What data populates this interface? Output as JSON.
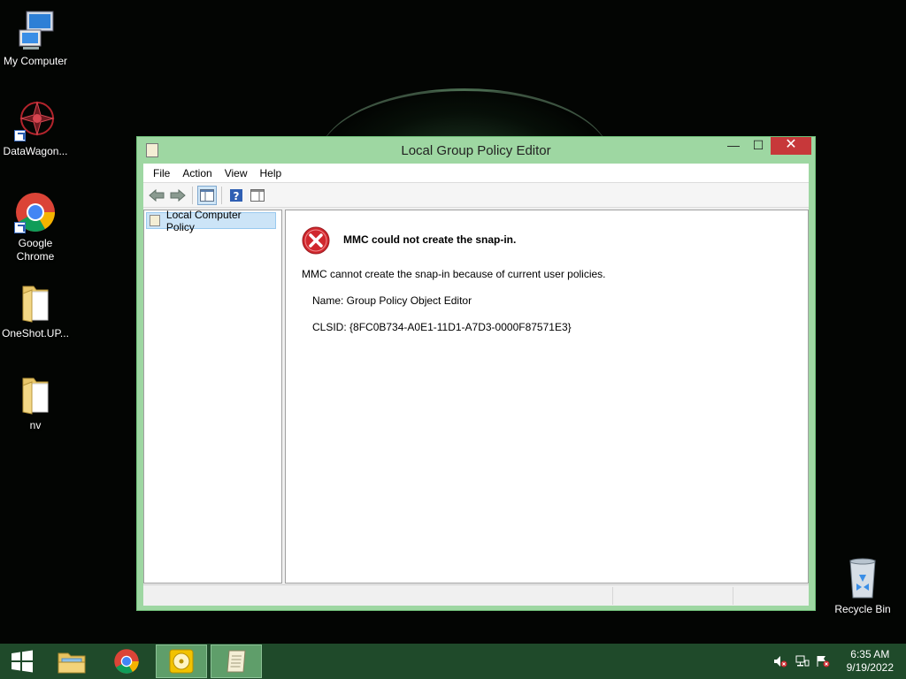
{
  "desktop": {
    "icons": [
      {
        "label": "My Computer"
      },
      {
        "label": "DataWagon..."
      },
      {
        "label": "Google Chrome"
      },
      {
        "label": "OneShot.UP..."
      },
      {
        "label": "nv"
      },
      {
        "label": "Recycle Bin"
      }
    ]
  },
  "window": {
    "title": "Local Group Policy Editor",
    "buttons": {
      "minimize": "—",
      "maximize": "☐",
      "close": "✕"
    },
    "menu": [
      "File",
      "Action",
      "View",
      "Help"
    ],
    "tree": {
      "root": "Local Computer Policy"
    },
    "error": {
      "title": "MMC could not create the snap-in.",
      "message": "MMC cannot create the snap-in because of current user policies.",
      "name_line": "Name: Group Policy Object Editor",
      "clsid_line": "CLSID: {8FC0B734-A0E1-11D1-A7D3-0000F87571E3}"
    }
  },
  "taskbar": {
    "clock_time": "6:35 AM",
    "clock_date": "9/19/2022"
  },
  "colors": {
    "window_frame": "#9ed7a2",
    "taskbar": "#1f4a2a",
    "close_button": "#c7383a",
    "error_red": "#d0272d"
  }
}
